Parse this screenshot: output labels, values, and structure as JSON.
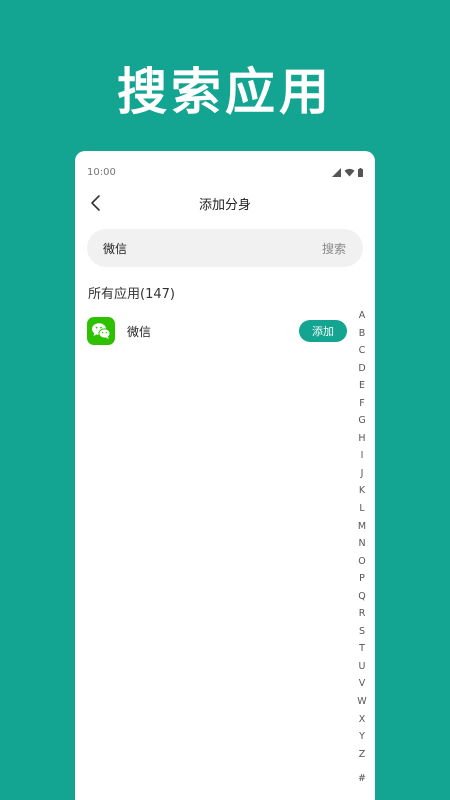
{
  "hero": {
    "title": "搜索应用"
  },
  "status_bar": {
    "time": "10:00"
  },
  "nav": {
    "title": "添加分身"
  },
  "search": {
    "value": "微信",
    "action_label": "搜索"
  },
  "section": {
    "header": "所有应用(147)"
  },
  "apps": [
    {
      "name": "微信",
      "icon": "wechat-icon",
      "action_label": "添加"
    }
  ],
  "index_bar": {
    "letters": [
      "A",
      "B",
      "C",
      "D",
      "E",
      "F",
      "G",
      "H",
      "I",
      "J",
      "K",
      "L",
      "M",
      "N",
      "O",
      "P",
      "Q",
      "R",
      "S",
      "T",
      "U",
      "V",
      "W",
      "X",
      "Y",
      "Z"
    ],
    "extra": "#"
  },
  "colors": {
    "accent": "#13A591",
    "wechat_green": "#2DC100",
    "search_bg": "#F1F1F1"
  }
}
